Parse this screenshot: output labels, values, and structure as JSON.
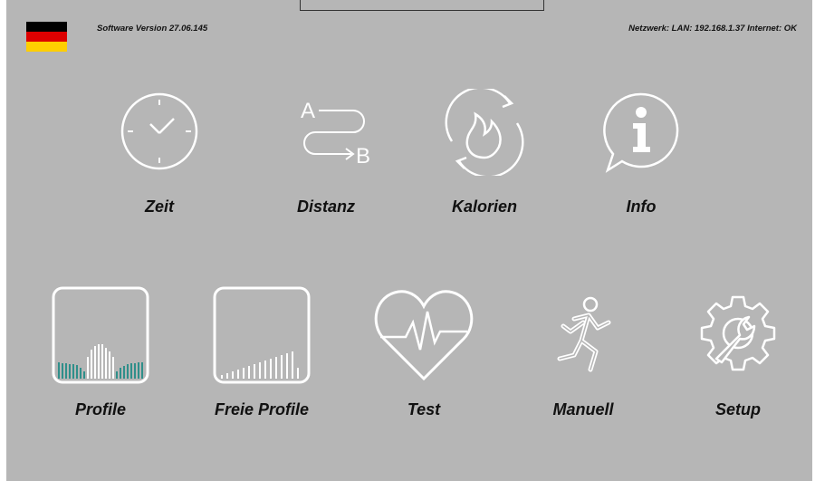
{
  "header": {
    "software_version": "Software Version 27.06.145",
    "network_status": "Netzwerk: LAN: 192.168.1.37 Internet: OK",
    "flag_colors": [
      "#000000",
      "#dd0000",
      "#ffce00"
    ]
  },
  "colors": {
    "background": "#b6b6b6",
    "icon": "#ffffff",
    "accent": "#2f8f8a",
    "text": "#111111"
  },
  "menu": {
    "zeit": {
      "label": "Zeit",
      "icon": "clock-icon"
    },
    "distanz": {
      "label": "Distanz",
      "icon": "route-icon",
      "from": "A",
      "to": "B"
    },
    "kalorien": {
      "label": "Kalorien",
      "icon": "flame-icon"
    },
    "info": {
      "label": "Info",
      "icon": "info-icon"
    },
    "profile": {
      "label": "Profile",
      "icon": "profile-chart-icon"
    },
    "freie_profile": {
      "label": "Freie Profile",
      "icon": "free-profile-icon"
    },
    "test": {
      "label": "Test",
      "icon": "heart-pulse-icon"
    },
    "manuell": {
      "label": "Manuell",
      "icon": "runner-icon"
    },
    "setup": {
      "label": "Setup",
      "icon": "gear-wrench-icon"
    }
  }
}
